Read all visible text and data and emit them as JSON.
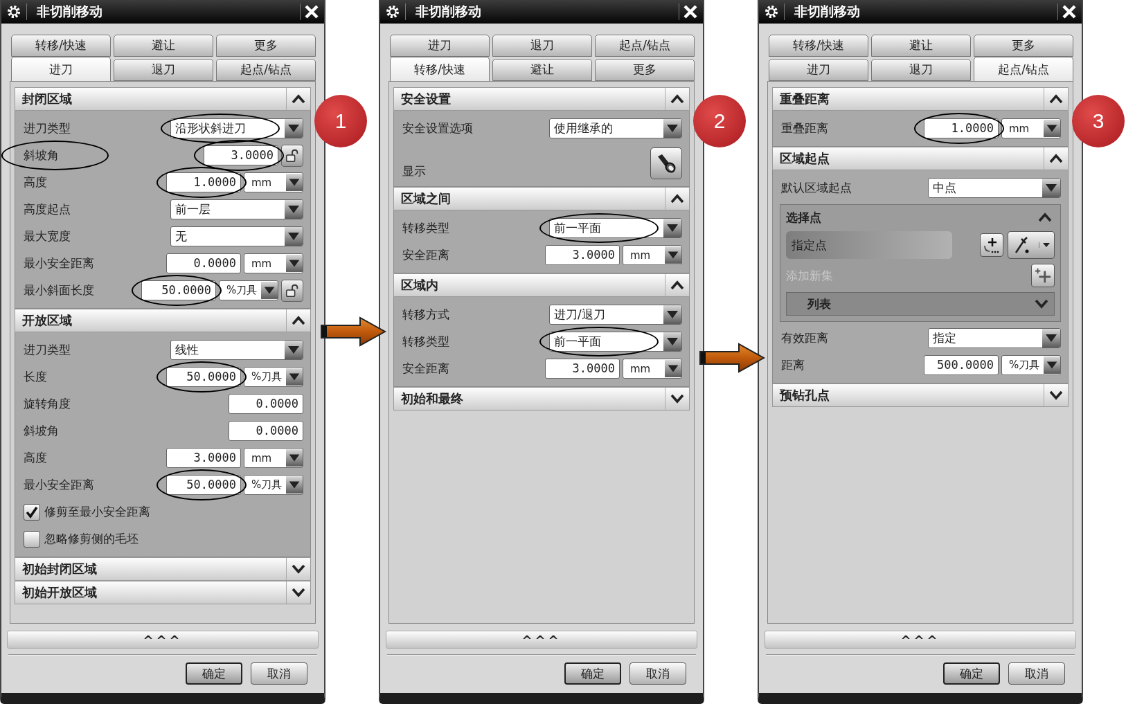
{
  "dialogs": [
    {
      "title": "非切削移动",
      "badge": "1",
      "tab_rows": [
        [
          {
            "label": "转移/快速",
            "selected": false
          },
          {
            "label": "避让",
            "selected": false
          },
          {
            "label": "更多",
            "selected": false
          }
        ],
        [
          {
            "label": "进刀",
            "selected": true
          },
          {
            "label": "退刀",
            "selected": false
          },
          {
            "label": "起点/钻点",
            "selected": false
          }
        ]
      ],
      "sections": [
        {
          "title": "封闭区域",
          "expanded": true,
          "rows": [
            {
              "kind": "dropdown",
              "label": "进刀类型",
              "value": "沿形状斜进刀",
              "circled": true
            },
            {
              "kind": "number",
              "label": "斜坡角",
              "label_circled": true,
              "value": "3.0000",
              "circled": true,
              "lock": true
            },
            {
              "kind": "number",
              "label": "高度",
              "value": "1.0000",
              "unit": "mm",
              "circled": true
            },
            {
              "kind": "dropdown",
              "label": "高度起点",
              "value": "前一层"
            },
            {
              "kind": "dropdown",
              "label": "最大宽度",
              "value": "无"
            },
            {
              "kind": "number",
              "label": "最小安全距离",
              "value": "0.0000",
              "unit": "mm"
            },
            {
              "kind": "number",
              "label": "最小斜面长度",
              "value": "50.0000",
              "unit": "%刀具",
              "lock": true,
              "circled": true
            }
          ]
        },
        {
          "title": "开放区域",
          "expanded": true,
          "rows": [
            {
              "kind": "dropdown",
              "label": "进刀类型",
              "value": "线性"
            },
            {
              "kind": "number",
              "label": "长度",
              "value": "50.0000",
              "unit": "%刀具",
              "circled": true
            },
            {
              "kind": "number",
              "label": "旋转角度",
              "value": "0.0000"
            },
            {
              "kind": "number",
              "label": "斜坡角",
              "value": "0.0000"
            },
            {
              "kind": "number",
              "label": "高度",
              "value": "3.0000",
              "unit": "mm"
            },
            {
              "kind": "number",
              "label": "最小安全距离",
              "value": "50.0000",
              "unit": "%刀具",
              "circled": true
            },
            {
              "kind": "checkbox",
              "label": "修剪至最小安全距离",
              "checked": true
            },
            {
              "kind": "checkbox",
              "label": "忽略修剪侧的毛坯",
              "checked": false
            }
          ]
        },
        {
          "title": "初始封闭区域",
          "expanded": false
        },
        {
          "title": "初始开放区域",
          "expanded": false
        }
      ],
      "more_bar": "^^^",
      "buttons": [
        {
          "label": "确定",
          "default": true
        },
        {
          "label": "取消",
          "default": false
        }
      ]
    },
    {
      "title": "非切削移动",
      "badge": "2",
      "tab_rows": [
        [
          {
            "label": "进刀",
            "selected": false
          },
          {
            "label": "退刀",
            "selected": false
          },
          {
            "label": "起点/钻点",
            "selected": false
          }
        ],
        [
          {
            "label": "转移/快速",
            "selected": true
          },
          {
            "label": "避让",
            "selected": false
          },
          {
            "label": "更多",
            "selected": false
          }
        ]
      ],
      "sections": [
        {
          "title": "安全设置",
          "expanded": true,
          "rows": [
            {
              "kind": "dropdown",
              "label": "安全设置选项",
              "value": "使用继承的"
            },
            {
              "kind": "icon_button",
              "label": "显示"
            }
          ]
        },
        {
          "title": "区域之间",
          "expanded": true,
          "rows": [
            {
              "kind": "dropdown",
              "label": "转移类型",
              "value": "前一平面",
              "circled": true
            },
            {
              "kind": "number",
              "label": "安全距离",
              "value": "3.0000",
              "unit": "mm"
            }
          ]
        },
        {
          "title": "区域内",
          "expanded": true,
          "rows": [
            {
              "kind": "dropdown",
              "label": "转移方式",
              "value": "进刀/退刀"
            },
            {
              "kind": "dropdown",
              "label": "转移类型",
              "value": "前一平面",
              "circled": true
            },
            {
              "kind": "number",
              "label": "安全距离",
              "value": "3.0000",
              "unit": "mm"
            }
          ]
        },
        {
          "title": "初始和最终",
          "expanded": false
        }
      ],
      "more_bar": "^^^",
      "buttons": [
        {
          "label": "确定",
          "default": true
        },
        {
          "label": "取消",
          "default": false
        }
      ]
    },
    {
      "title": "非切削移动",
      "badge": "3",
      "tab_rows": [
        [
          {
            "label": "转移/快速",
            "selected": false
          },
          {
            "label": "避让",
            "selected": false
          },
          {
            "label": "更多",
            "selected": false
          }
        ],
        [
          {
            "label": "进刀",
            "selected": false
          },
          {
            "label": "退刀",
            "selected": false
          },
          {
            "label": "起点/钻点",
            "selected": true
          }
        ]
      ],
      "sections": [
        {
          "title": "重叠距离",
          "expanded": true,
          "rows": [
            {
              "kind": "number",
              "label": "重叠距离",
              "value": "1.0000",
              "unit": "mm",
              "circled": true
            }
          ]
        },
        {
          "title": "区域起点",
          "expanded": true,
          "rows": [
            {
              "kind": "dropdown",
              "label": "默认区域起点",
              "value": "中点"
            },
            {
              "kind": "group",
              "title": "选择点",
              "expanded": true,
              "rows": [
                {
                  "kind": "point",
                  "label": "指定点"
                },
                {
                  "kind": "add_set",
                  "label": "添加新集",
                  "disabled": true
                },
                {
                  "kind": "list",
                  "title": "列表",
                  "expanded": false
                }
              ]
            },
            {
              "kind": "dropdown",
              "label": "有效距离",
              "value": "指定"
            },
            {
              "kind": "number",
              "label": "距离",
              "value": "500.0000",
              "unit": "%刀具"
            }
          ]
        },
        {
          "title": "预钻孔点",
          "expanded": false
        }
      ],
      "more_bar": "^^^",
      "buttons": [
        {
          "label": "确定",
          "default": true
        },
        {
          "label": "取消",
          "default": false
        }
      ]
    }
  ]
}
